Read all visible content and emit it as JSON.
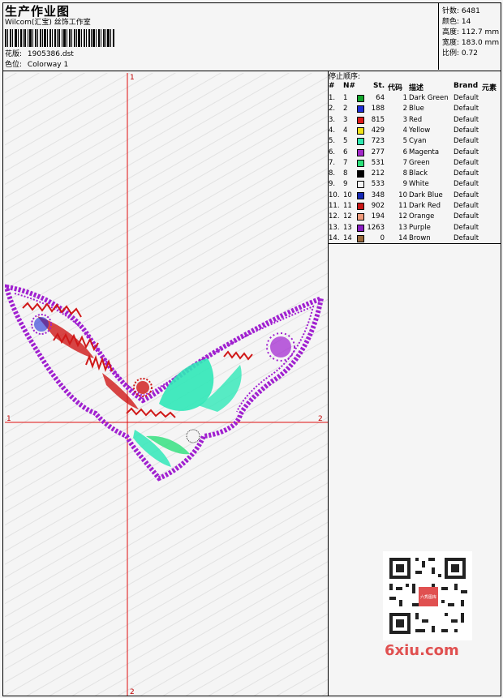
{
  "header": {
    "title": "生产作业图",
    "company": "Wilcom(汇宝) 丝饰工作室",
    "design_file_label": "花版:",
    "design_file_value": "1905386.dst",
    "colorway_label": "色位:",
    "colorway_value": "Colorway 1"
  },
  "stats": {
    "stitches_label": "针数:",
    "stitches_value": "6481",
    "colors_label": "颜色:",
    "colors_value": "14",
    "height_label": "高度:",
    "height_value": "112.7 mm",
    "width_label": "宽度:",
    "width_value": "183.0 mm",
    "ratio_label": "比例:",
    "ratio_value": "0.72"
  },
  "sequence": {
    "title": "停止顺序:",
    "columns": [
      "#",
      "N#",
      "St.",
      "代码",
      "描述",
      "Brand",
      "元素"
    ],
    "rows": [
      {
        "idx": "1.",
        "n": "1",
        "color": "#11a52c",
        "st": "64",
        "code": "1",
        "desc": "Dark Green",
        "brand": "Default"
      },
      {
        "idx": "2.",
        "n": "2",
        "color": "#1f2ed6",
        "st": "188",
        "code": "2",
        "desc": "Blue",
        "brand": "Default"
      },
      {
        "idx": "3.",
        "n": "3",
        "color": "#dc1a1a",
        "st": "815",
        "code": "3",
        "desc": "Red",
        "brand": "Default"
      },
      {
        "idx": "4.",
        "n": "4",
        "color": "#f0e21a",
        "st": "429",
        "code": "4",
        "desc": "Yellow",
        "brand": "Default"
      },
      {
        "idx": "5.",
        "n": "5",
        "color": "#2ee8b0",
        "st": "723",
        "code": "5",
        "desc": "Cyan",
        "brand": "Default"
      },
      {
        "idx": "6.",
        "n": "6",
        "color": "#a228c8",
        "st": "277",
        "code": "6",
        "desc": "Magenta",
        "brand": "Default"
      },
      {
        "idx": "7.",
        "n": "7",
        "color": "#2be07a",
        "st": "531",
        "code": "7",
        "desc": "Green",
        "brand": "Default"
      },
      {
        "idx": "8.",
        "n": "8",
        "color": "#000000",
        "st": "212",
        "code": "8",
        "desc": "Black",
        "brand": "Default"
      },
      {
        "idx": "9.",
        "n": "9",
        "color": "#f4f4f4",
        "st": "533",
        "code": "9",
        "desc": "White",
        "brand": "Default"
      },
      {
        "idx": "10.",
        "n": "10",
        "color": "#1428b4",
        "st": "348",
        "code": "10",
        "desc": "Dark Blue",
        "brand": "Default"
      },
      {
        "idx": "11.",
        "n": "11",
        "color": "#c81414",
        "st": "902",
        "code": "11",
        "desc": "Dark Red",
        "brand": "Default"
      },
      {
        "idx": "12.",
        "n": "12",
        "color": "#f09a7a",
        "st": "194",
        "code": "12",
        "desc": "Orange",
        "brand": "Default"
      },
      {
        "idx": "13.",
        "n": "13",
        "color": "#8a1ec2",
        "st": "1263",
        "code": "13",
        "desc": "Purple",
        "brand": "Default"
      },
      {
        "idx": "14.",
        "n": "14",
        "color": "#9a6a3c",
        "st": "0",
        "code": "14",
        "desc": "Brown",
        "brand": "Default"
      }
    ]
  },
  "axes": {
    "top": "1",
    "bottom": "2",
    "left": "1",
    "right": "2"
  },
  "watermark": {
    "site": "6xiu.com",
    "seal": "六秀图库"
  },
  "colors": {
    "axis": "#e01010",
    "outline": "#a020d0",
    "red": "#d01818",
    "cyan": "#30e8b8",
    "watermark": "#e05050"
  }
}
